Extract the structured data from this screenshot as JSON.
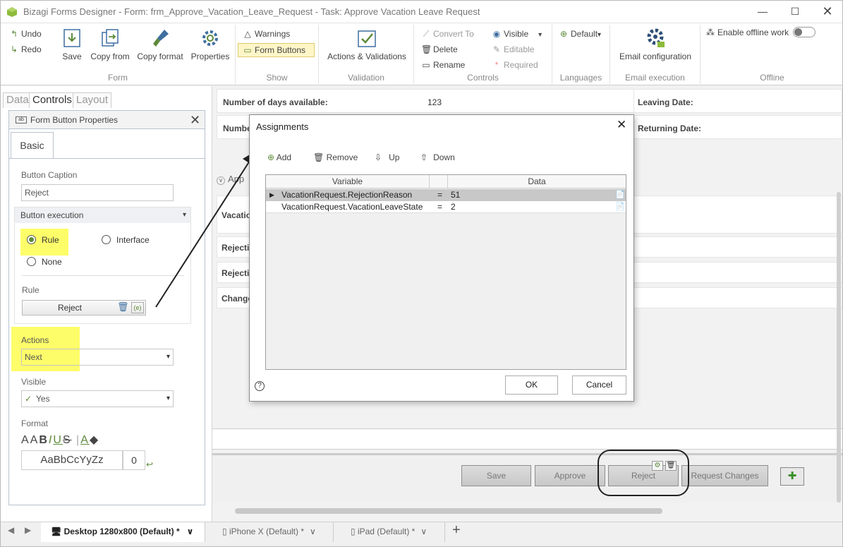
{
  "window": {
    "title": "Bizagi Forms Designer  - Form: frm_Approve_Vacation_Leave_Request - Task:  Approve Vacation Leave Request"
  },
  "ribbon": {
    "undo": "Undo",
    "redo": "Redo",
    "save": "Save",
    "copy_from": "Copy from",
    "copy_format": "Copy format",
    "properties": "Properties",
    "group_form": "Form",
    "warnings": "Warnings",
    "form_buttons": "Form Buttons",
    "group_show": "Show",
    "actions_validations": "Actions & Validations",
    "group_validation": "Validation",
    "convert_to": "Convert To",
    "delete": "Delete",
    "rename": "Rename",
    "visible": "Visible",
    "editable": "Editable",
    "required": "Required",
    "group_controls": "Controls",
    "default_lang": "Default",
    "group_languages": "Languages",
    "email_configuration": "Email configuration",
    "group_email": "Email execution",
    "enable_offline": "Enable offline work",
    "group_offline": "Offline"
  },
  "left_tabs": {
    "data": "Data",
    "controls": "Controls",
    "layout": "Layout"
  },
  "props": {
    "title": "Form Button Properties",
    "basic_tab": "Basic",
    "caption_label": "Button Caption",
    "caption_value": "Reject",
    "execution_label": "Button execution",
    "opt_rule": "Rule",
    "opt_interface": "Interface",
    "opt_none": "None",
    "rule_label": "Rule",
    "rule_value": "Reject",
    "actions_label": "Actions",
    "actions_value": "Next",
    "visible_label": "Visible",
    "visible_value": "Yes",
    "format_label": "Format",
    "font_preview": "AaBbCcYyZz",
    "font_size": "0"
  },
  "form": {
    "days_available_label": "Number of days available:",
    "days_available_value": "123",
    "number_label_partial": "Numbe",
    "leaving_date_label": "Leaving Date:",
    "returning_date_label": "Returning Date:",
    "section_partial": "App",
    "row_vacation_partial": "Vacatio",
    "row_rejection1_partial": "Rejectio",
    "row_rejection2_partial": "Rejectio",
    "row_change_partial": "Change",
    "buttons": [
      "Save",
      "Approve",
      "Reject",
      "Request Changes"
    ]
  },
  "dialog": {
    "title": "Assignments",
    "add": "Add",
    "remove": "Remove",
    "up": "Up",
    "down": "Down",
    "col_variable": "Variable",
    "col_data": "Data",
    "rows": [
      {
        "variable": "VacationRequest.RejectionReason",
        "op": "=",
        "data": "51"
      },
      {
        "variable": "VacationRequest.VacationLeaveState",
        "op": "=",
        "data": "2"
      }
    ],
    "ok": "OK",
    "cancel": "Cancel"
  },
  "bottom_tabs": [
    {
      "label": "Desktop 1280x800 (Default) *"
    },
    {
      "label": "iPhone X (Default) *"
    },
    {
      "label": "iPad (Default) *"
    }
  ],
  "colors": {
    "highlight": "#fdfd6a",
    "accent_green": "#5d8a3a",
    "form_buttons_bg": "#fff6c8"
  }
}
